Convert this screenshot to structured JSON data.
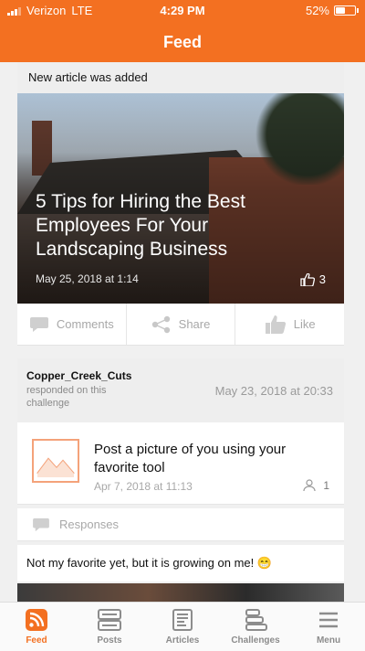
{
  "status_bar": {
    "carrier": "Verizon",
    "network": "LTE",
    "time": "4:29 PM",
    "battery": "52%",
    "battery_level": 0.52
  },
  "header": {
    "title": "Feed"
  },
  "notice": {
    "text": "New article was added"
  },
  "article": {
    "title": "5 Tips for Hiring the Best Employees For Your Landscaping Business",
    "date": "May 25, 2018 at 1:14",
    "likes": "3",
    "icons": {
      "like": "thumbs-up-icon"
    }
  },
  "actions": {
    "comments_label": "Comments",
    "share_label": "Share",
    "like_label": "Like"
  },
  "challenge_activity": {
    "user": "Copper_Creek_Cuts",
    "action": "responded on this challenge",
    "date": "May 23, 2018 at 20:33"
  },
  "challenge": {
    "title": "Post a picture of you using your favorite tool",
    "date": "Apr 7, 2018 at 11:13",
    "participants": "1"
  },
  "responses": {
    "label": "Responses"
  },
  "comment": {
    "text": "Not my favorite yet, but it is growing on me! 😁"
  },
  "tabs": [
    {
      "label": "Feed",
      "icon": "rss-icon",
      "active": true
    },
    {
      "label": "Posts",
      "icon": "posts-icon",
      "active": false
    },
    {
      "label": "Articles",
      "icon": "articles-icon",
      "active": false
    },
    {
      "label": "Challenges",
      "icon": "challenges-icon",
      "active": false
    },
    {
      "label": "Menu",
      "icon": "menu-icon",
      "active": false
    }
  ],
  "colors": {
    "accent": "#f37021",
    "inactive": "#8c8c8c"
  }
}
